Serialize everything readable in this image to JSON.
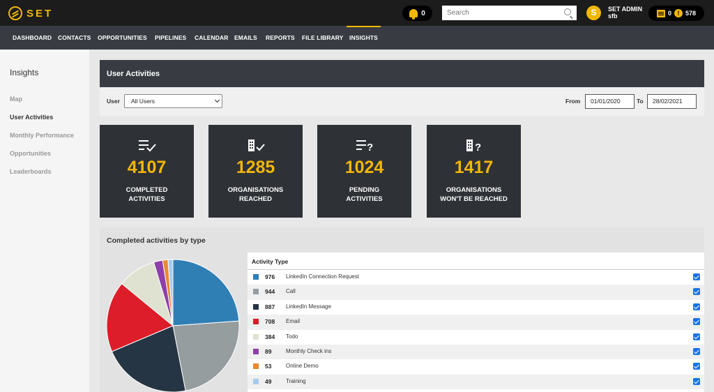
{
  "app": {
    "logo_text": "SET"
  },
  "topbar": {
    "notifications_count": "0",
    "search_placeholder": "Search",
    "avatar_letter": "S",
    "user_name": "SET ADMIN",
    "user_sub": "sfb",
    "calendar_count": "0",
    "alert_count": "578"
  },
  "nav": {
    "items": [
      "DASHBOARD",
      "CONTACTS",
      "OPPORTUNITIES",
      "PIPELINES",
      "CALENDAR",
      "EMAILS",
      "REPORTS",
      "FILE LIBRARY",
      "INSIGHTS"
    ],
    "active": "INSIGHTS"
  },
  "sidebar": {
    "title": "Insights",
    "items": [
      "Map",
      "User Activities",
      "Monthly Performance",
      "Opportunities",
      "Leaderboards"
    ],
    "active": "User Activities"
  },
  "page": {
    "title": "User Activities",
    "user_label": "User",
    "user_value": "All Users",
    "from_label": "From",
    "from_value": "01/01/2020",
    "to_label": "To",
    "to_value": "28/02/2021"
  },
  "cards": [
    {
      "value": "4107",
      "label": "COMPLETED\nACTIVITIES",
      "icon": "list-check-icon"
    },
    {
      "value": "1285",
      "label": "ORGANISATIONS\nREACHED",
      "icon": "building-check-icon"
    },
    {
      "value": "1024",
      "label": "PENDING\nACTIVITIES",
      "icon": "list-question-icon"
    },
    {
      "value": "1417",
      "label": "ORGANISATIONS\nWON'T BE REACHED",
      "icon": "building-question-icon"
    }
  ],
  "chart_title": "Completed activities by type",
  "legend_header": "Activity Type",
  "chart_data": {
    "type": "pie",
    "title": "Completed activities by type",
    "series": [
      {
        "name": "LinkedIn Connection Request",
        "value": 976,
        "color": "#2f7fb5"
      },
      {
        "name": "Call",
        "value": 944,
        "color": "#959d9f"
      },
      {
        "name": "LinkedIn Message",
        "value": 887,
        "color": "#263544"
      },
      {
        "name": "Email",
        "value": 708,
        "color": "#dd1d2a"
      },
      {
        "name": "Todo",
        "value": 384,
        "color": "#dfe2d0"
      },
      {
        "name": "Monthly Check ins",
        "value": 89,
        "color": "#8e3fa8"
      },
      {
        "name": "Online Demo",
        "value": 53,
        "color": "#e88a2f"
      },
      {
        "name": "Training",
        "value": 49,
        "color": "#a9cbeb"
      }
    ]
  }
}
